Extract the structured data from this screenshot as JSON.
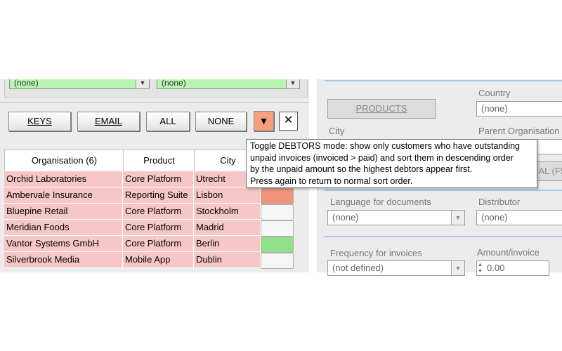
{
  "filters": {
    "left_combo": "(none)",
    "right_combo": "(none)"
  },
  "toolbar": {
    "keys_label": "KEYS",
    "email_label": "EMAIL",
    "all_label": "ALL",
    "none_label": "NONE",
    "debtors_symbol": "▼",
    "close_symbol": "✕"
  },
  "table": {
    "headers": [
      "Organisation (6)",
      "Product",
      "City"
    ],
    "rows": [
      {
        "org": "Orchid Laboratories",
        "product": "Core Platform",
        "city": "Utrecht",
        "status_color": "#f0937a"
      },
      {
        "org": "Ambervale Insurance",
        "product": "Reporting Suite",
        "city": "Lisbon",
        "status_color": "#f0937a"
      },
      {
        "org": "Bluepine Retail",
        "product": "Core Platform",
        "city": "Stockholm",
        "status_color": "#f6f6f6"
      },
      {
        "org": "Meridian Foods",
        "product": "Core Platform",
        "city": "Madrid",
        "status_color": "#f6f6f6"
      },
      {
        "org": "Vantor Systems GmbH",
        "product": "Core Platform",
        "city": "Berlin",
        "status_color": "#92e089"
      },
      {
        "org": "Silverbrook Media",
        "product": "Mobile App",
        "city": "Dublin",
        "status_color": "#f6f6f6"
      }
    ]
  },
  "tooltip": {
    "lines": [
      "Toggle DEBTORS mode: show only customers who have outstanding",
      "unpaid invoices (invoiced > paid) and sort them in descending order",
      "by the unpaid amount so the highest debtors appear first.",
      "Press again to return to normal sort order."
    ]
  },
  "details": {
    "products_button": "PRODUCTS",
    "country_label": "Country",
    "country_value": "(none)",
    "city_label": "City",
    "parent_org_label": "Parent Organisation",
    "partial_button": "AL (F5",
    "language_label": "Language for documents",
    "language_value": "(none)",
    "distributor_label": "Distributor",
    "distributor_value": "(none)",
    "frequency_label": "Frequency for invoices",
    "frequency_value": "(not defined)",
    "amount_label": "Amount/invoice",
    "amount_value": "0.00"
  },
  "colors": {
    "row_bg": "#f7c7c8",
    "combo_bg": "#b9f5b2",
    "debtors_btn": "#f4a07d"
  }
}
